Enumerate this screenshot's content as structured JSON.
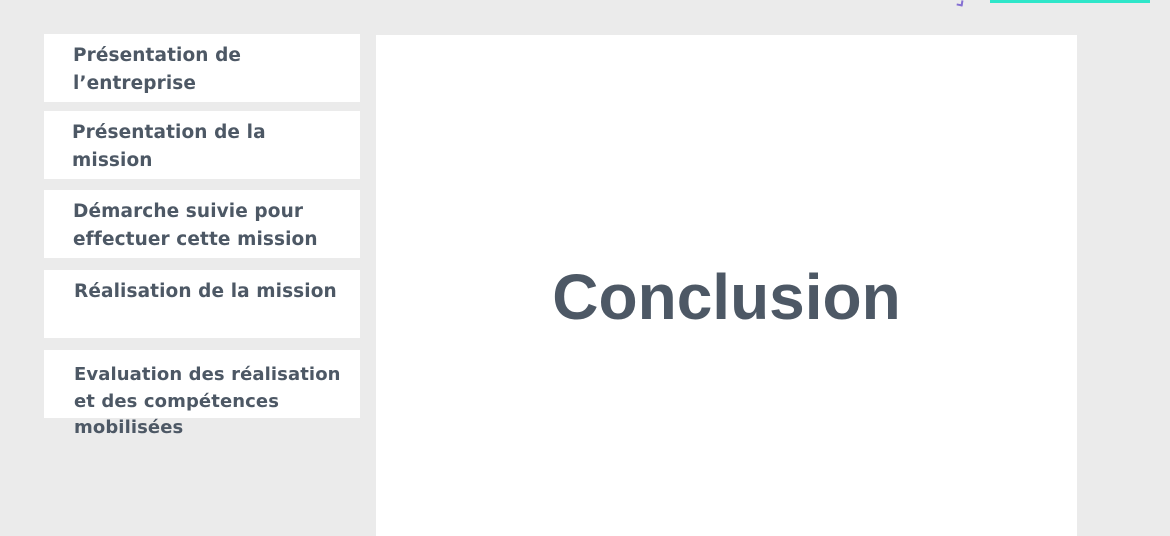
{
  "nav": {
    "items": [
      {
        "label": "Présentation de l’entreprise"
      },
      {
        "label": "Présentation de la mission"
      },
      {
        "label": "Démarche suivie pour effectuer cette mission"
      },
      {
        "label": "Réalisation de la mission"
      },
      {
        "label": "Evaluation des réalisation et des compétences mobilisées"
      }
    ]
  },
  "content": {
    "title": "Conclusion"
  },
  "colors": {
    "background": "#ebebeb",
    "panel": "#ffffff",
    "text": "#4d5865",
    "accent": "#2ee6c9"
  }
}
